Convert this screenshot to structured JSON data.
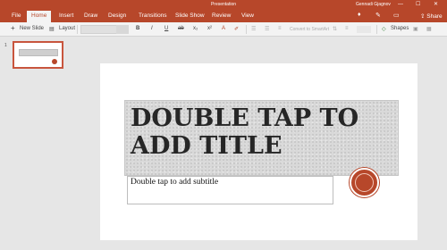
{
  "titlebar": {
    "document_title": "Presentation",
    "user_name": "Gennadi Gjagnov",
    "minimize": "—",
    "maximize": "☐",
    "close": "✕"
  },
  "ribbon": {
    "tabs": [
      "File",
      "Home",
      "Insert",
      "Draw",
      "Design",
      "Transitions",
      "Slide Show",
      "Review",
      "View"
    ],
    "active_tab": "Home",
    "share_label": "Share"
  },
  "toolbar": {
    "new_slide_label": "New Slide",
    "layout_label": "Layout",
    "bold": "B",
    "italic": "I",
    "underline": "U",
    "strikethrough": "ab",
    "subscript": "x₂",
    "superscript": "x²",
    "font_color": "A",
    "convert_smartart_label": "Convert to SmartArt",
    "shapes_label": "Shapes"
  },
  "thumbnails": [
    {
      "number": "1"
    }
  ],
  "slide": {
    "title_placeholder": "DOUBLE TAP TO ADD TITLE",
    "subtitle_placeholder": "Double tap to add subtitle"
  },
  "colors": {
    "accent": "#b7472a",
    "ribbon_bg": "#f3f3f3",
    "canvas_bg": "#e6e6e6"
  }
}
